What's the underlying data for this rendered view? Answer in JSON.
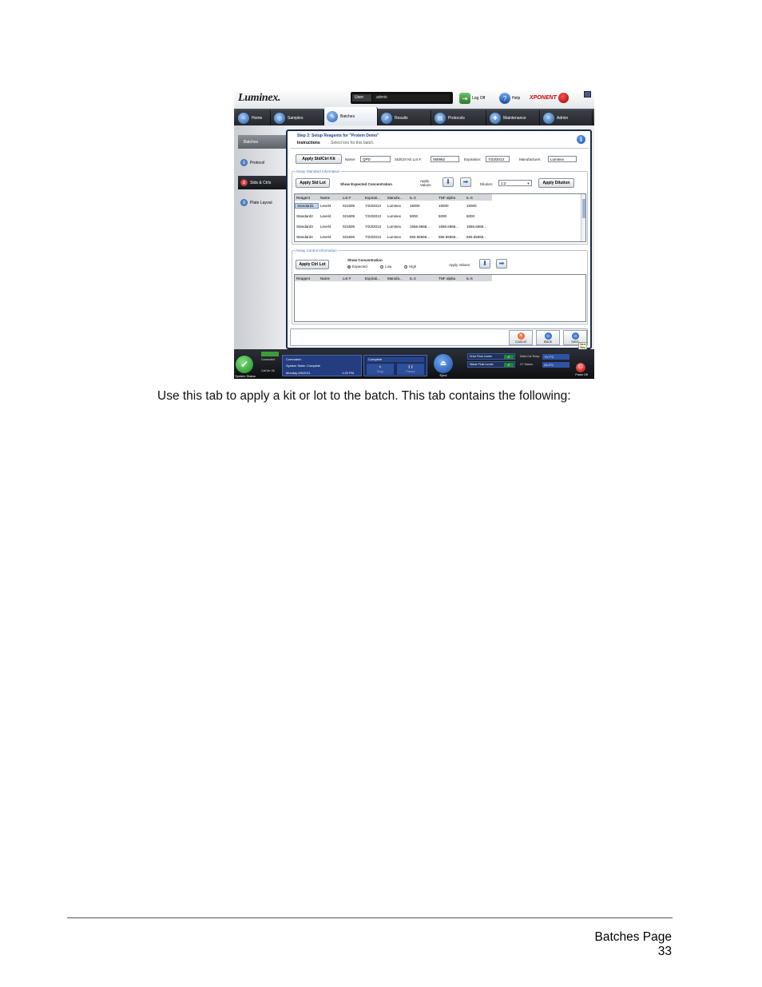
{
  "app": {
    "logo": "Luminex.",
    "user_label": "User:",
    "user_value": "admin",
    "logoff_label": "Log Off",
    "help_label": "Help",
    "brand": "XPONENT"
  },
  "tabs": [
    "Home",
    "Samples",
    "Batches",
    "Results",
    "Protocols",
    "Maintenance",
    "Admin"
  ],
  "leftnav": {
    "header": "Batches",
    "steps": [
      {
        "num": "1",
        "label": "Protocol"
      },
      {
        "num": "2",
        "label": "Stds & Ctrls"
      },
      {
        "num": "3",
        "label": "Plate Layout"
      }
    ]
  },
  "main": {
    "step_title": "Step 2: Setup Reagents for \"Protein Demo\"",
    "instructions_label": "Instructions",
    "instructions_text": "Select lots for this batch.",
    "info_icon": "i",
    "apply_kit_button": "Apply Std/Ctrl Kit",
    "name_label": "Name:",
    "name_value": "QPD",
    "kit_lot_label": "Std/Ctrl Kit Lot #:",
    "kit_lot_value": "060982",
    "expiration_label": "Expiration:",
    "expiration_value": "7/23/2013",
    "manufacturer_label": "Manufacturer:",
    "manufacturer_value": "Luminex",
    "standard_group": {
      "title": "Assay Standard Information",
      "apply_lot_button": "Apply Std Lot",
      "show_expected": "Show Expected Concentration",
      "apply_values_label": "Apply Values:",
      "dilution_label": "Dilution:",
      "dilution_value": "1:2",
      "apply_dilution_button": "Apply Dilution",
      "columns": [
        "Reagent",
        "Name",
        "Lot #",
        "Expirati...",
        "Manufa...",
        "IL-2",
        "TNF alpha",
        "IL-6"
      ],
      "rows": [
        [
          "Standard1",
          "Level4",
          "021605",
          "7/23/2013",
          "Luminex",
          "15000",
          "15000",
          "15000"
        ],
        [
          "Standard2",
          "Level4",
          "021605",
          "7/23/2013",
          "Luminex",
          "5000",
          "5000",
          "5000"
        ],
        [
          "Standard3",
          "Level4",
          "021605",
          "7/23/2013",
          "Luminex",
          "1666.6666...",
          "1666.6666...",
          "1666.6666..."
        ],
        [
          "Standard4",
          "Level4",
          "021605",
          "7/23/2013",
          "Luminex",
          "555.55555...",
          "555.55555...",
          "555.55555..."
        ]
      ]
    },
    "control_group": {
      "title": "Assay Control Information",
      "apply_lot_button": "Apply Ctrl Lot",
      "show_concentration": "Show Concentration",
      "radio_expected": "Expected",
      "radio_low": "Low",
      "radio_high": "High",
      "apply_values_label": "Apply Values:",
      "columns": [
        "Reagent",
        "Name",
        "Lot #",
        "Expirati...",
        "Manufa...",
        "IL-2",
        "TNF alpha",
        "IL-6"
      ]
    },
    "nav": {
      "cancel": "Cancel",
      "back": "Back",
      "next": "Next",
      "tooltip": "Next Step"
    }
  },
  "status": {
    "system_status": "System Status",
    "connected": "Connected",
    "cal_ok": "Cal/Ver Ok",
    "command_label": "Command:",
    "system_state": "System State:  Complete",
    "date": "Monday 6/6/2011",
    "time": "1:25 PM",
    "run_state": "Complete",
    "stop": "Stop",
    "pause": "Pause",
    "eject": "Eject",
    "drive_fluid": "Drive Fluid Levels",
    "waste_fluid": "Waste Fluid Levels",
    "delta_cal_temp": "Delta Cal Temp:",
    "delta_cal_temp_value": "+0.7°C",
    "xy_status": "XY Status:",
    "xy_status_value": "24.0°C",
    "power_off": "Power Off"
  },
  "document": {
    "body": "Use this tab to apply a kit or lot to the batch. This tab contains the following:",
    "footer_section": "Batches Page",
    "footer_page": "33"
  },
  "colors": {
    "accent_blue": "#1b3e8c",
    "selected_step": "#b01010",
    "status_ok": "#1a8a1a"
  }
}
